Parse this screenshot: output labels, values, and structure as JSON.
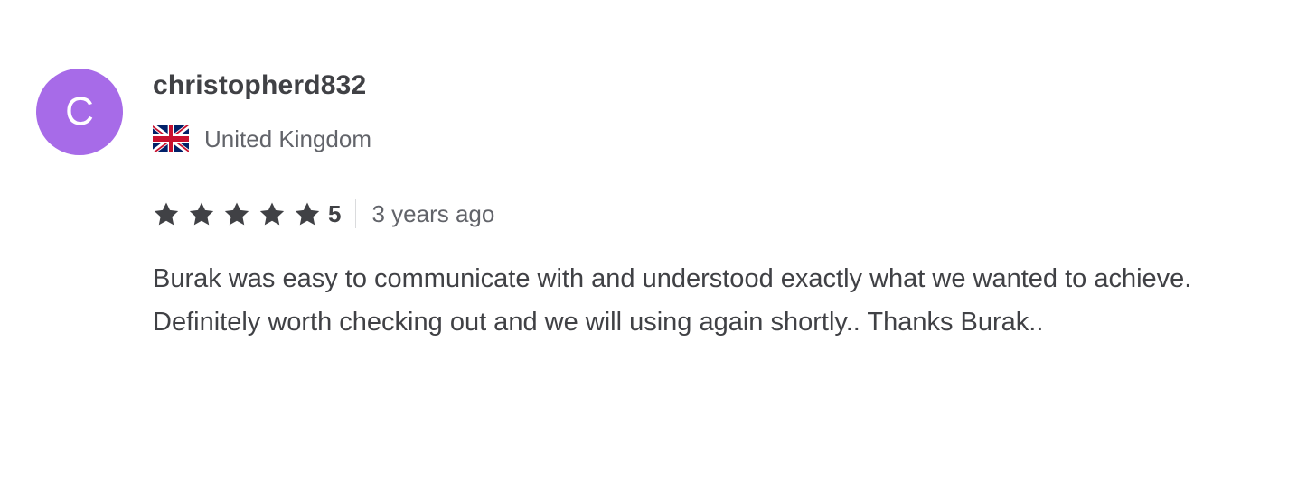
{
  "review": {
    "avatar_letter": "C",
    "avatar_color": "#a76be8",
    "username": "christopherd832",
    "country": "United Kingdom",
    "flag_icon": "uk-flag-icon",
    "star_icon": "star-icon",
    "star_color": "#404145",
    "rating": 5,
    "rating_label": "5",
    "time_ago": "3 years ago",
    "text": "Burak was easy to communicate with and understood exactly what we wanted to achieve. Definitely worth checking out and we will using again shortly.. Thanks Burak.."
  }
}
